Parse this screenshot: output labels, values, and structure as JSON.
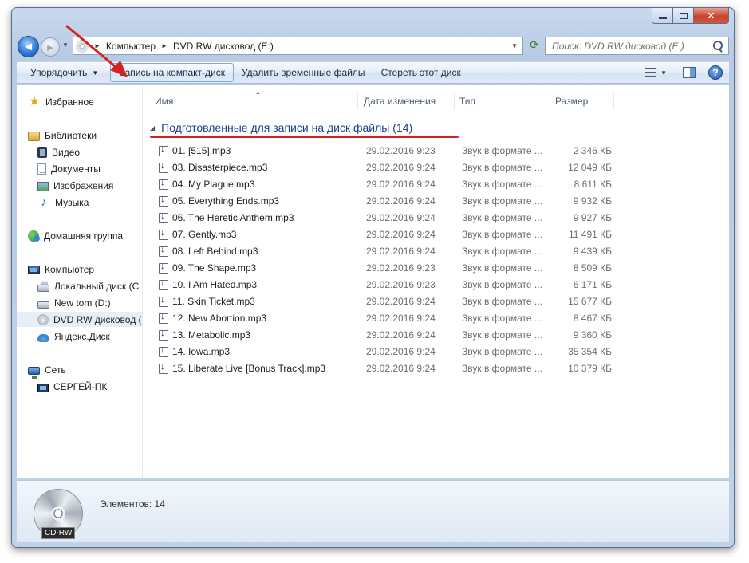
{
  "window": {
    "caption_buttons": {
      "minimize": "minimize-icon",
      "maximize": "maximize-icon",
      "close": "✕"
    }
  },
  "nav": {
    "back_glyph": "◄",
    "forward_glyph": "►",
    "breadcrumbs": [
      "Компьютер",
      "DVD RW дисковод (E:)"
    ],
    "refresh_glyph": "⟳",
    "search_placeholder": "Поиск: DVD RW дисковод (E:)"
  },
  "toolbar": {
    "organize": "Упорядочить",
    "burn": "Запись на компакт-диск",
    "delete_temp": "Удалить временные файлы",
    "erase": "Стереть этот диск",
    "help": "?"
  },
  "sidebar": {
    "favorites": "Избранное",
    "libraries": "Библиотеки",
    "video": "Видео",
    "documents": "Документы",
    "images": "Изображения",
    "music": "Музыка",
    "homegroup": "Домашняя группа",
    "computer": "Компьютер",
    "local_disk": "Локальный диск (С",
    "new_tom": "New tom (D:)",
    "dvd": "DVD RW дисковод (",
    "yandex": "Яндекс.Диск",
    "network": "Сеть",
    "network_pc": "СЕРГЕЙ-ПК"
  },
  "columns": {
    "name": "Имя",
    "date": "Дата изменения",
    "type": "Тип",
    "size": "Размер"
  },
  "group": {
    "title": "Подготовленные для записи на диск файлы (14)"
  },
  "files": [
    {
      "name": "01. [515].mp3",
      "date": "29.02.2016 9:23",
      "type": "Звук в формате ...",
      "size": "2 346 КБ"
    },
    {
      "name": "03. Disasterpiece.mp3",
      "date": "29.02.2016 9:24",
      "type": "Звук в формате ...",
      "size": "12 049 КБ"
    },
    {
      "name": "04. My Plague.mp3",
      "date": "29.02.2016 9:24",
      "type": "Звук в формате ...",
      "size": "8 611 КБ"
    },
    {
      "name": "05. Everything Ends.mp3",
      "date": "29.02.2016 9:24",
      "type": "Звук в формате ...",
      "size": "9 932 КБ"
    },
    {
      "name": "06. The Heretic Anthem.mp3",
      "date": "29.02.2016 9:24",
      "type": "Звук в формате ...",
      "size": "9 927 КБ"
    },
    {
      "name": "07. Gently.mp3",
      "date": "29.02.2016 9:24",
      "type": "Звук в формате ...",
      "size": "11 491 КБ"
    },
    {
      "name": "08. Left Behind.mp3",
      "date": "29.02.2016 9:24",
      "type": "Звук в формате ...",
      "size": "9 439 КБ"
    },
    {
      "name": "09. The Shape.mp3",
      "date": "29.02.2016 9:23",
      "type": "Звук в формате ...",
      "size": "8 509 КБ"
    },
    {
      "name": "10. I Am Hated.mp3",
      "date": "29.02.2016 9:23",
      "type": "Звук в формате ...",
      "size": "6 171 КБ"
    },
    {
      "name": "11. Skin Ticket.mp3",
      "date": "29.02.2016 9:24",
      "type": "Звук в формате ...",
      "size": "15 677 КБ"
    },
    {
      "name": "12. New Abortion.mp3",
      "date": "29.02.2016 9:24",
      "type": "Звук в формате ...",
      "size": "8 467 КБ"
    },
    {
      "name": "13. Metabolic.mp3",
      "date": "29.02.2016 9:24",
      "type": "Звук в формате ...",
      "size": "9 360 КБ"
    },
    {
      "name": "14. Iowa.mp3",
      "date": "29.02.2016 9:24",
      "type": "Звук в формате ...",
      "size": "35 354 КБ"
    },
    {
      "name": "15. Liberate Live [Bonus Track].mp3",
      "date": "29.02.2016 9:24",
      "type": "Звук в формате ...",
      "size": "10 379 КБ"
    }
  ],
  "details": {
    "cd_label": "CD-RW",
    "count": "Элементов: 14"
  },
  "colors": {
    "annotation": "#d6231c",
    "group_title": "#1e3d8a"
  }
}
